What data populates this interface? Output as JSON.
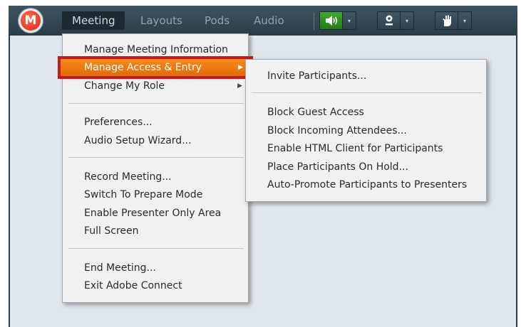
{
  "menubar": {
    "logo_letter": "M",
    "menus": [
      "Meeting",
      "Layouts",
      "Pods",
      "Audio"
    ],
    "buttons": [
      {
        "icon": "speaker-icon",
        "dropdown": "▾"
      },
      {
        "icon": "webcam-icon",
        "dropdown": "▾"
      },
      {
        "icon": "raise-hand-icon",
        "dropdown": "▾"
      }
    ]
  },
  "meeting_menu": {
    "groups": [
      [
        "Manage Meeting Information",
        "Manage Access & Entry",
        "Change My Role"
      ],
      [
        "Preferences...",
        "Audio Setup Wizard..."
      ],
      [
        "Record Meeting...",
        "Switch To Prepare Mode",
        "Enable Presenter Only Area",
        "Full Screen"
      ],
      [
        "End Meeting...",
        "Exit Adobe Connect"
      ]
    ],
    "selected": "Manage Access & Entry",
    "submenu_arrow": "▶"
  },
  "access_submenu": {
    "groups": [
      [
        "Invite Participants..."
      ],
      [
        "Block Guest Access",
        "Block Incoming Attendees...",
        "Enable HTML Client for Participants",
        "Place Participants On Hold...",
        "Auto-Promote Participants to Presenters"
      ]
    ]
  },
  "colors": {
    "menubar": "#2f4450",
    "highlight": "#f07a12",
    "highlight_outline": "#c41a1a",
    "audio_button": "#2e9620"
  }
}
